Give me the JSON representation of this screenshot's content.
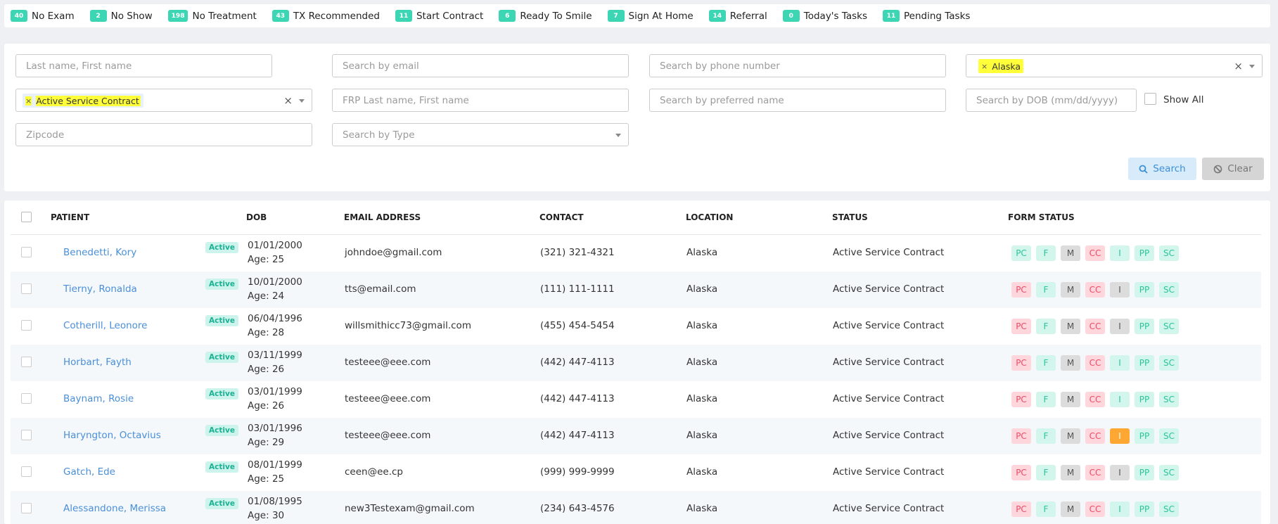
{
  "stats": [
    {
      "count": "40",
      "label": "No Exam"
    },
    {
      "count": "2",
      "label": "No Show"
    },
    {
      "count": "198",
      "label": "No Treatment"
    },
    {
      "count": "43",
      "label": "TX Recommended"
    },
    {
      "count": "11",
      "label": "Start Contract"
    },
    {
      "count": "6",
      "label": "Ready To Smile"
    },
    {
      "count": "7",
      "label": "Sign At Home"
    },
    {
      "count": "14",
      "label": "Referral"
    },
    {
      "count": "0",
      "label": "Today's Tasks"
    },
    {
      "count": "11",
      "label": "Pending Tasks"
    }
  ],
  "filters": {
    "name_placeholder": "Last name, First name",
    "email_placeholder": "Search by email",
    "phone_placeholder": "Search by phone number",
    "location_tag": "Alaska",
    "status_tag": "Active Service Contract",
    "frp_placeholder": "FRP Last name, First name",
    "preferred_placeholder": "Search by preferred name",
    "dob_placeholder": "Search by DOB (mm/dd/yyyy)",
    "show_all_label": "Show All",
    "zip_placeholder": "Zipcode",
    "type_placeholder": "Search by Type",
    "search_button": "Search",
    "clear_button": "Clear",
    "tag_remove": "×",
    "clear_all": "×"
  },
  "table": {
    "headers": {
      "patient": "PATIENT",
      "dob": "DOB",
      "email": "EMAIL ADDRESS",
      "contact": "CONTACT",
      "location": "LOCATION",
      "status": "STATUS",
      "form_status": "FORM STATUS"
    },
    "form_labels": [
      "PC",
      "F",
      "M",
      "CC",
      "I",
      "PP",
      "SC"
    ],
    "status_colors": {
      "pink": "#ffd6dc",
      "mint": "#d2f5ec",
      "grey": "#dcdcdc",
      "orange": "#ffa733"
    },
    "rows": [
      {
        "name": "Benedetti, Kory",
        "badge": "Active",
        "dob": "01/01/2000",
        "age": "Age: 25",
        "email": "johndoe@gmail.com",
        "contact": "(321) 321-4321",
        "location": "Alaska",
        "status": "Active Service Contract",
        "forms": [
          "mint",
          "mint",
          "grey",
          "pink",
          "mint",
          "mint",
          "mint"
        ]
      },
      {
        "name": "Tierny, Ronalda",
        "badge": "Active",
        "dob": "10/01/2000",
        "age": "Age: 24",
        "email": "tts@email.com",
        "contact": "(111) 111-1111",
        "location": "Alaska",
        "status": "Active Service Contract",
        "forms": [
          "pink",
          "mint",
          "grey",
          "pink",
          "grey",
          "mint",
          "mint"
        ]
      },
      {
        "name": "Cotherill, Leonore",
        "badge": "Active",
        "dob": "06/04/1996",
        "age": "Age: 28",
        "email": "willsmithicc73@gmail.com",
        "contact": "(455) 454-5454",
        "location": "Alaska",
        "status": "Active Service Contract",
        "forms": [
          "pink",
          "mint",
          "grey",
          "pink",
          "grey",
          "mint",
          "mint"
        ]
      },
      {
        "name": "Horbart, Fayth",
        "badge": "Active",
        "dob": "03/11/1999",
        "age": "Age: 26",
        "email": "testeee@eee.com",
        "contact": "(442) 447-4113",
        "location": "Alaska",
        "status": "Active Service Contract",
        "forms": [
          "pink",
          "mint",
          "grey",
          "pink",
          "mint",
          "mint",
          "mint"
        ]
      },
      {
        "name": "Baynam, Rosie",
        "badge": "Active",
        "dob": "03/01/1999",
        "age": "Age: 26",
        "email": "testeee@eee.com",
        "contact": "(442) 447-4113",
        "location": "Alaska",
        "status": "Active Service Contract",
        "forms": [
          "pink",
          "mint",
          "grey",
          "pink",
          "mint",
          "mint",
          "mint"
        ]
      },
      {
        "name": "Haryngton, Octavius",
        "badge": "Active",
        "dob": "03/01/1996",
        "age": "Age: 29",
        "email": "testeee@eee.com",
        "contact": "(442) 447-4113",
        "location": "Alaska",
        "status": "Active Service Contract",
        "forms": [
          "pink",
          "mint",
          "grey",
          "pink",
          "orange",
          "mint",
          "mint"
        ]
      },
      {
        "name": "Gatch, Ede",
        "badge": "Active",
        "dob": "08/01/1999",
        "age": "Age: 25",
        "email": "ceen@ee.cp",
        "contact": "(999) 999-9999",
        "location": "Alaska",
        "status": "Active Service Contract",
        "forms": [
          "pink",
          "mint",
          "grey",
          "pink",
          "grey",
          "mint",
          "mint"
        ]
      },
      {
        "name": "Alessandone, Merissa",
        "badge": "Active",
        "dob": "01/08/1995",
        "age": "Age: 30",
        "email": "new3Testexam@gmail.com",
        "contact": "(234) 643-4576",
        "location": "Alaska",
        "status": "Active Service Contract",
        "forms": [
          "pink",
          "mint",
          "grey",
          "pink",
          "mint",
          "mint",
          "mint"
        ]
      }
    ]
  }
}
